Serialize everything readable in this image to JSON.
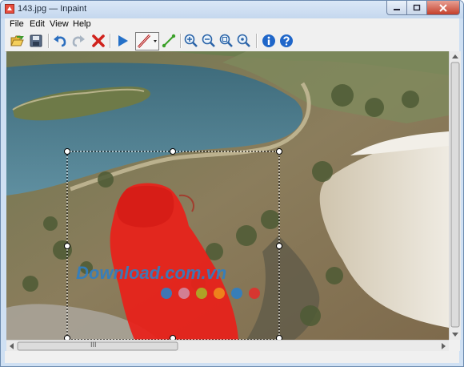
{
  "window": {
    "title": "143.jpg — Inpaint"
  },
  "menu": {
    "items": [
      "File",
      "Edit",
      "View",
      "Help"
    ]
  },
  "toolbar": {
    "buttons": [
      "open-icon",
      "save-icon",
      "undo-icon",
      "redo-icon",
      "delete-icon",
      "play-icon",
      "marker-pen-icon",
      "line-tool-icon",
      "zoom-in-icon",
      "zoom-out-icon",
      "zoom-fit-icon",
      "zoom-actual-icon",
      "info-icon",
      "help-icon"
    ]
  },
  "canvas": {
    "watermark": "Download.com.vn",
    "watermark_dots": [
      "#2f7fc4",
      "#d08aa0",
      "#a8b028",
      "#f08c1c",
      "#2f7fc4",
      "#e0312c"
    ],
    "mask_color": "#e8201a"
  },
  "scrollbar": {
    "grip": "III"
  }
}
